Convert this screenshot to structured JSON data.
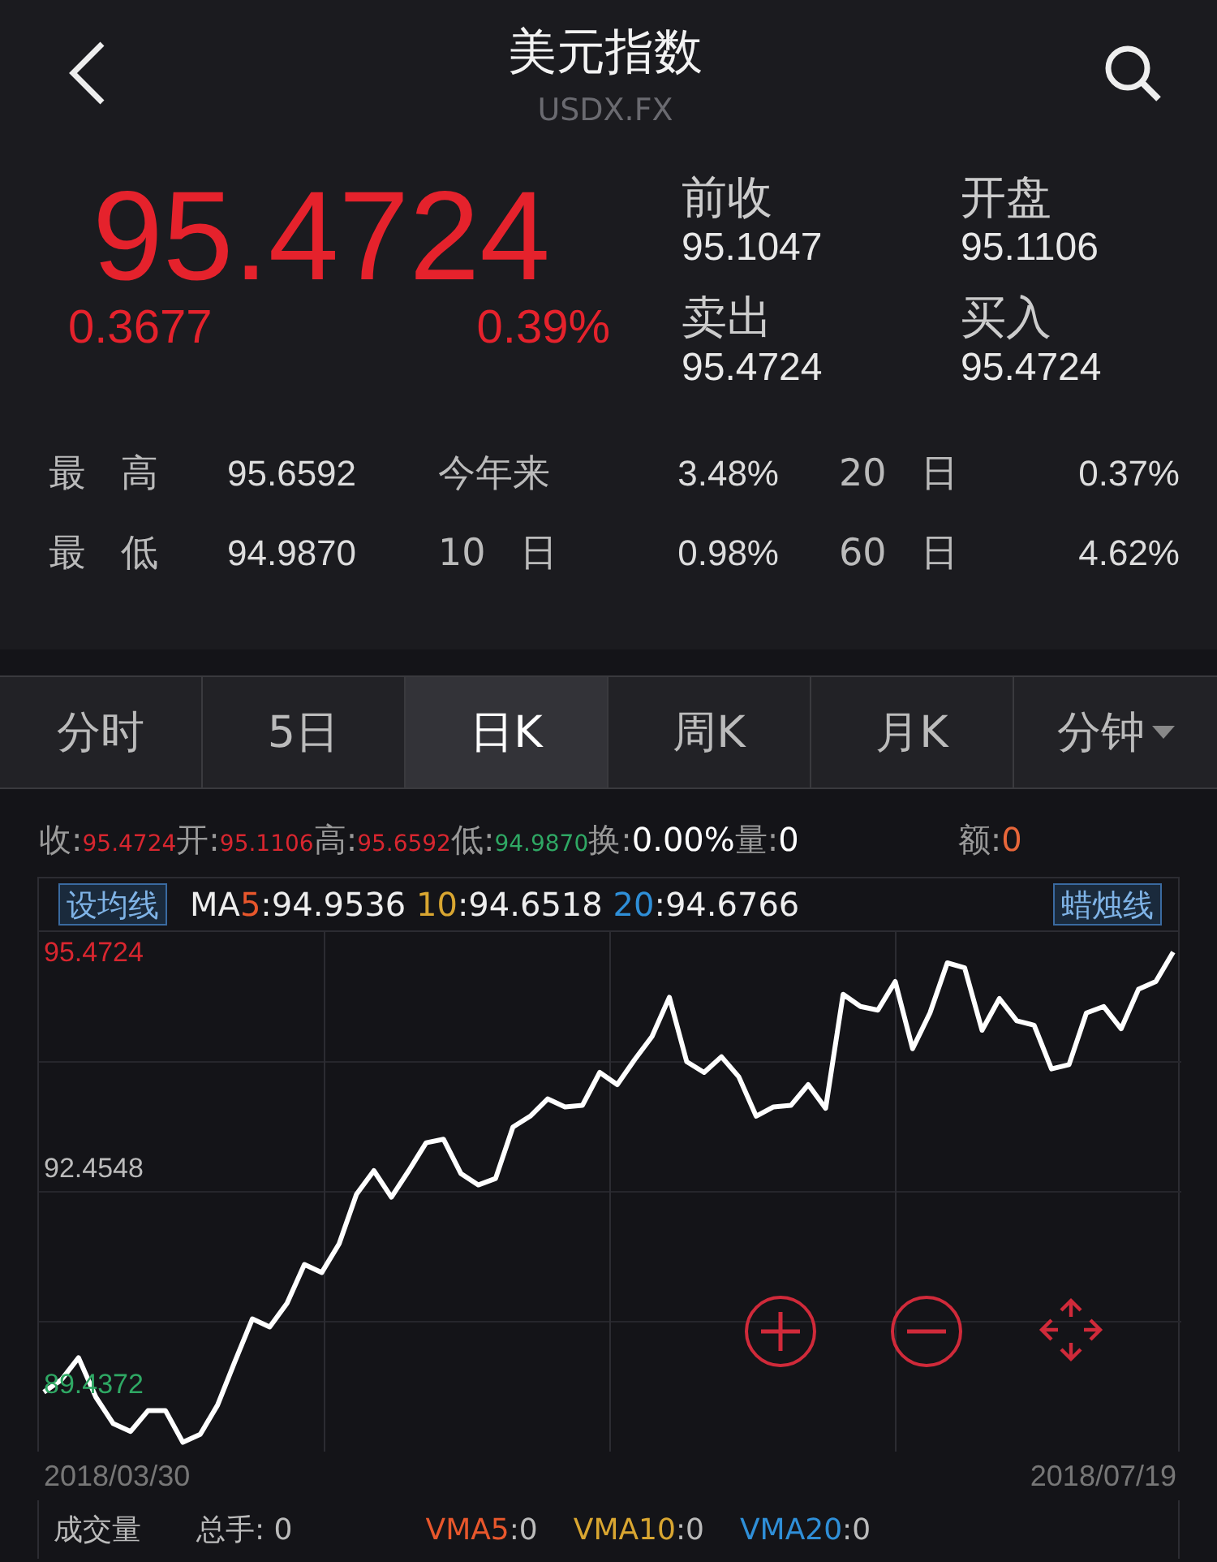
{
  "header": {
    "title": "美元指数",
    "subtitle": "USDX.FX"
  },
  "quote": {
    "price": "95.4724",
    "change": "0.3677",
    "change_pct": "0.39%",
    "fields": [
      {
        "label": "前收",
        "value": "95.1047"
      },
      {
        "label": "开盘",
        "value": "95.1106"
      },
      {
        "label": "卖出",
        "value": "95.4724"
      },
      {
        "label": "买入",
        "value": "95.4724"
      }
    ]
  },
  "stats": [
    [
      {
        "label": "最 高",
        "value": "95.6592"
      },
      {
        "label": "今年来",
        "value": "3.48%"
      },
      {
        "label": "20 日",
        "value": "0.37%"
      }
    ],
    [
      {
        "label": "最 低",
        "value": "94.9870"
      },
      {
        "label": "10 日",
        "value": "0.98%"
      },
      {
        "label": "60 日",
        "value": "4.62%"
      }
    ]
  ],
  "tabs": [
    {
      "label": "分时",
      "selected": false,
      "menu": false
    },
    {
      "label": "5日",
      "selected": false,
      "menu": false
    },
    {
      "label": "日K",
      "selected": true,
      "menu": false
    },
    {
      "label": "周K",
      "selected": false,
      "menu": false
    },
    {
      "label": "月K",
      "selected": false,
      "menu": false
    },
    {
      "label": "分钟",
      "selected": false,
      "menu": true
    }
  ],
  "info_row": [
    {
      "label": "收:",
      "value": "95.4724",
      "color": "#d8262f"
    },
    {
      "label": "开:",
      "value": "95.1106",
      "color": "#d8262f"
    },
    {
      "label": "高:",
      "value": "95.6592",
      "color": "#d8262f"
    },
    {
      "label": "低:",
      "value": "94.9870",
      "color": "#2fa864"
    },
    {
      "label": "换:",
      "value": "0.00%",
      "color": "#ffffff"
    },
    {
      "label": "量:",
      "value": "0",
      "color": "#ffffff"
    },
    {
      "label": "额:",
      "value": "0",
      "color": "#e8673a"
    }
  ],
  "ma_row": {
    "button": "设均线",
    "prefix": "MA",
    "items": [
      {
        "period": "5",
        "value": ":94.9536",
        "color": "#e8572c"
      },
      {
        "period": "10",
        "value": ":94.6518",
        "color": "#d9a631"
      },
      {
        "period": "20",
        "value": ":94.6766",
        "color": "#2f8fd8"
      }
    ],
    "style_button": "蜡烛线"
  },
  "chart_data": {
    "type": "line",
    "ylim": [
      88.5,
      95.75
    ],
    "yticks": [
      {
        "value": 95.4724,
        "label": "95.4724"
      },
      {
        "value": 92.4548,
        "label": "92.4548"
      },
      {
        "value": 89.4372,
        "label": "89.4372"
      }
    ],
    "series": [
      {
        "color": "#ffffff",
        "values": [
          89.33,
          89.5,
          89.81,
          89.26,
          88.89,
          88.78,
          89.07,
          89.07,
          88.63,
          88.74,
          89.15,
          89.76,
          90.35,
          90.24,
          90.57,
          91.11,
          91.0,
          91.4,
          92.09,
          92.42,
          92.05,
          92.42,
          92.81,
          92.86,
          92.38,
          92.22,
          92.31,
          93.03,
          93.18,
          93.42,
          93.31,
          93.33,
          93.79,
          93.62,
          93.97,
          94.29,
          94.84,
          93.94,
          93.79,
          94.01,
          93.73,
          93.18,
          93.31,
          93.33,
          93.62,
          93.29,
          94.88,
          94.71,
          94.66,
          95.06,
          94.12,
          94.62,
          95.32,
          95.25,
          94.38,
          94.82,
          94.51,
          94.45,
          93.84,
          93.9,
          94.62,
          94.71,
          94.4,
          94.95,
          95.06,
          95.47
        ]
      }
    ]
  },
  "dates": [
    "2018/03/30",
    "2018/07/19"
  ],
  "volume": {
    "title": "成交量",
    "total": "总手: 0",
    "items": [
      {
        "label": "VMA5",
        "value": ":0",
        "color": "#e8572c"
      },
      {
        "label": "VMA10",
        "value": ":0",
        "color": "#d9a631"
      },
      {
        "label": "VMA20",
        "value": ":0",
        "color": "#2f8fd8"
      }
    ]
  }
}
